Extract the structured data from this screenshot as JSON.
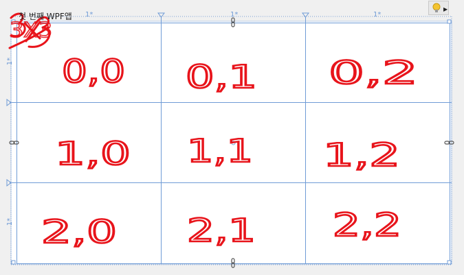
{
  "window": {
    "title": "첫 번째 WPF앱"
  },
  "grid": {
    "column_sizes": [
      "1*",
      "1*",
      "1*"
    ],
    "row_sizes": [
      "1*",
      "1*"
    ],
    "annotation": "3X3",
    "cells": [
      "0,0",
      "0,1",
      "0,2",
      "1,0",
      "1,1",
      "1,2",
      "2,0",
      "2,1",
      "2,2"
    ]
  },
  "colors": {
    "ink": "#e8141b",
    "gridline": "#6f9bd6",
    "canvas": "#ffffff",
    "chrome": "#f0f0f0"
  },
  "icons": {
    "quick_actions": "lightbulb-icon",
    "expand": "triangle-right-icon",
    "column_marker": "triangle-down-icon",
    "row_marker": "triangle-right-icon",
    "pin": "pin-icon"
  }
}
